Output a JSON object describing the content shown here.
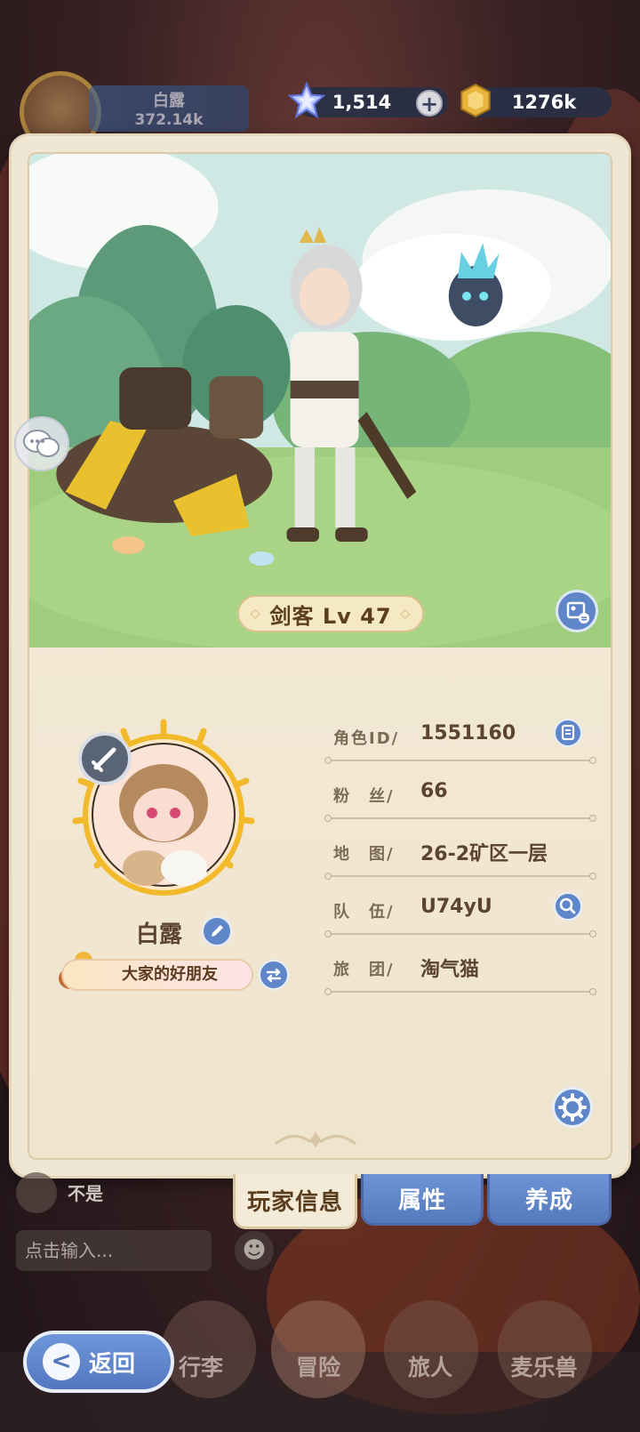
{
  "hud": {
    "player_name": "白露",
    "power": "372.14k",
    "gems": "1,514",
    "gold": "1276k"
  },
  "profile": {
    "class_level": "剑客 Lv 47",
    "name": "白露",
    "title": "大家的好朋友",
    "rows": [
      {
        "key": "角色ID/",
        "value": "1551160"
      },
      {
        "key": "粉　丝/",
        "value": "66"
      },
      {
        "key": "地　图/",
        "value": "26-2矿区一层"
      },
      {
        "key": "队　伍/",
        "value": "U74yU"
      },
      {
        "key": "旅　团/",
        "value": "淘气猫"
      }
    ]
  },
  "tabs": {
    "player_info": "玩家信息",
    "attributes": "属性",
    "cultivate": "养成"
  },
  "chat": {
    "last_message": "不是",
    "input_placeholder": "点击输入..."
  },
  "nav": {
    "back": "返回",
    "bag": "行李",
    "adventure": "冒险",
    "traveler": "旅人",
    "pet": "麦乐兽"
  },
  "colors": {
    "accent_blue": "#5f86c8",
    "card_bg": "#efe6d3",
    "text_brown": "#5b4530"
  },
  "icons": {
    "gem": "star-gem-icon",
    "gold": "gold-coin-icon",
    "copy": "copy-icon",
    "search": "search-icon",
    "settings": "gear-icon",
    "edit": "pencil-icon",
    "swap": "swap-icon",
    "photo": "photo-icon",
    "chat": "chat-bubble-icon"
  }
}
